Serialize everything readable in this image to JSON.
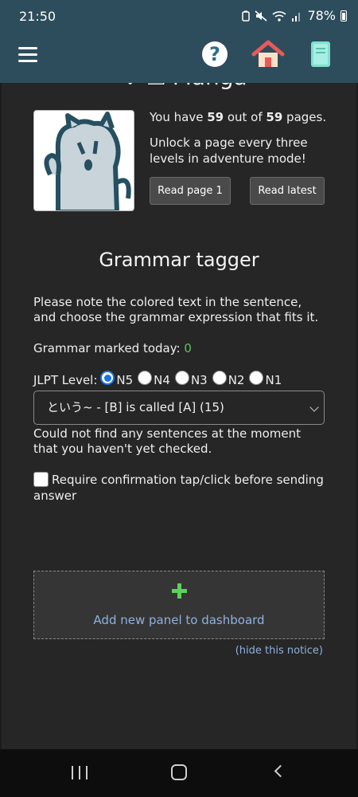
{
  "status_bar": {
    "time": "21:50",
    "battery": "78%",
    "icons": [
      "saver-icon",
      "mute-icon",
      "wifi-icon",
      "signal-icon",
      "battery-icon"
    ]
  },
  "header": {
    "icons": [
      "menu-icon",
      "help-icon",
      "home-icon",
      "book-icon"
    ],
    "help_glyph": "?"
  },
  "manga": {
    "heading_cut": "↓ ⇲ Manga",
    "pages_prefix": "You have ",
    "pages_have": "59",
    "pages_mid": " out of ",
    "pages_total": "59",
    "pages_suffix": " pages.",
    "unlock_text": "Unlock a page every three levels in adventure mode!",
    "read_first_label": "Read page 1",
    "read_latest_label": "Read latest"
  },
  "grammar": {
    "title": "Grammar tagger",
    "note": "Please note the colored text in the sentence, and choose the grammar expression that fits it.",
    "marked_label": "Grammar marked today: ",
    "marked_count": "0",
    "jlpt_label": "JLPT Level: ",
    "levels": [
      "N5",
      "N4",
      "N3",
      "N2",
      "N1"
    ],
    "selected_level": "N5",
    "selected_expression": "という~ - [B] is called [A] (15)",
    "not_found": "Could not find any sentences at the moment that you haven't yet checked.",
    "confirm_label": "Require confirmation tap/click before sending answer"
  },
  "dashboard": {
    "add_panel_label": "Add new panel to dashboard",
    "hide_notice_label": "(hide this notice)"
  },
  "colors": {
    "header_bg": "#2d4d5c",
    "content_bg": "#262626",
    "accent_green": "#5ed05e",
    "link_blue": "#8fb2dd",
    "radio_blue": "#1a73e8"
  }
}
